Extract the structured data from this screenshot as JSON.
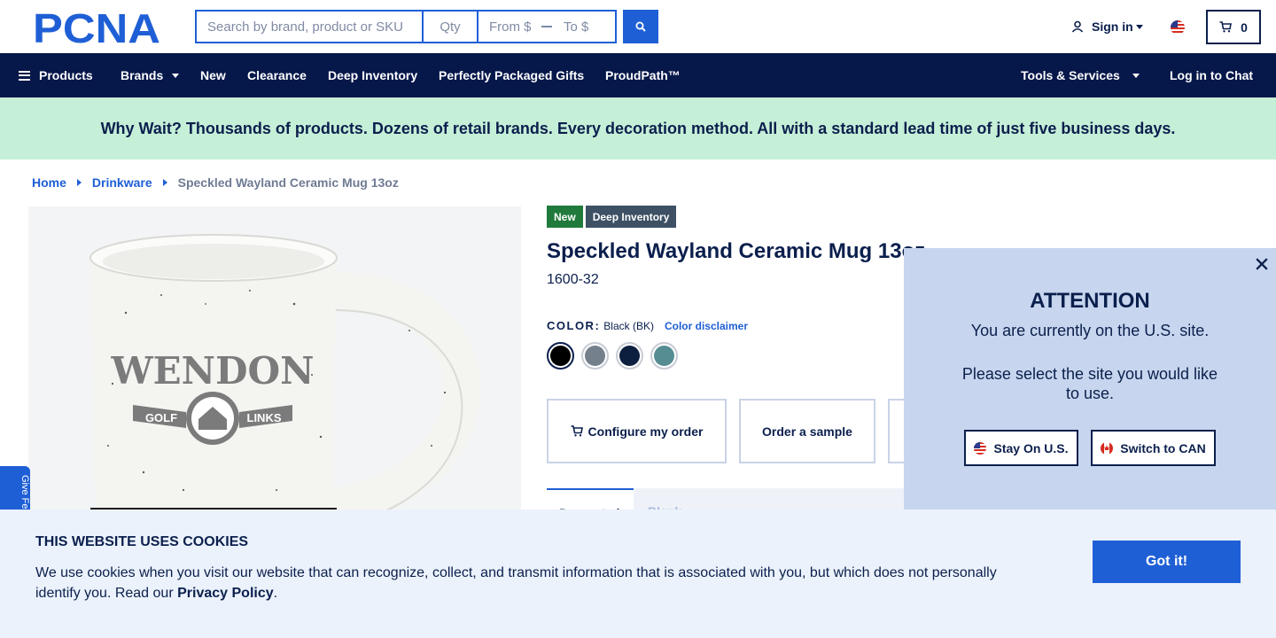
{
  "header": {
    "logo_text": "PCNA",
    "search": {
      "placeholder": "Search by brand, product or SKU"
    },
    "qty": {
      "placeholder": "Qty"
    },
    "price_from": {
      "placeholder": "From $"
    },
    "price_to": {
      "placeholder": "To $"
    },
    "search_button_icon": "search-icon",
    "signin_label": "Sign in",
    "cart_count": "0"
  },
  "nav": {
    "items": [
      {
        "label": "Products"
      },
      {
        "label": "Brands"
      },
      {
        "label": "New"
      },
      {
        "label": "Clearance"
      },
      {
        "label": "Deep Inventory"
      },
      {
        "label": "Perfectly Packaged Gifts"
      },
      {
        "label": "ProudPath™"
      }
    ],
    "tools_label": "Tools & Services",
    "chat_label": "Log in to Chat"
  },
  "promo": {
    "text": "Why Wait? Thousands of products. Dozens of retail brands. Every decoration method. All with a standard lead time of just five business days."
  },
  "breadcrumb": {
    "items": [
      "Home",
      "Drinkware"
    ],
    "current": "Speckled Wayland Ceramic Mug 13oz"
  },
  "product": {
    "image_text": {
      "top": "WENDON",
      "left": "GOLF",
      "right": "LINKS"
    },
    "badges": [
      "New",
      "Deep Inventory"
    ],
    "title": "Speckled Wayland Ceramic Mug 13oz",
    "sku": "1600-32",
    "color_label": "COLOR:",
    "color_value": "Black (BK)",
    "color_disclaimer": "Color disclaimer",
    "swatches": [
      {
        "name": "black",
        "color": "#000000"
      },
      {
        "name": "gray",
        "color": "#75808d"
      },
      {
        "name": "navy",
        "color": "#0c1f3f"
      },
      {
        "name": "teal",
        "color": "#568d93"
      }
    ],
    "configure_label": "Configure my order",
    "sample_label": "Order a sample",
    "tabs": [
      "Decorated",
      "Blank"
    ]
  },
  "feedback": {
    "label": "Give Fe"
  },
  "modal": {
    "title": "ATTENTION",
    "line1": "You are currently on the U.S. site.",
    "line2": "Please select the site you would like to use.",
    "stay_label": "Stay On U.S.",
    "switch_label": "Switch to CAN"
  },
  "cookie": {
    "title": "THIS WEBSITE USES COOKIES",
    "text": "We use cookies when you visit our website that can recognize, collect, and transmit information that is associated with you, but which does not personally identify you. Read our",
    "link": "Privacy Policy",
    "period": ".",
    "button": "Got it!"
  },
  "colors": {
    "navy": "#06174a",
    "accent_blue": "#1f5fd6",
    "promo_green": "#c6efd8",
    "modal_bg": "#c7d6ee",
    "cookie_bg": "#ebf2fb"
  }
}
